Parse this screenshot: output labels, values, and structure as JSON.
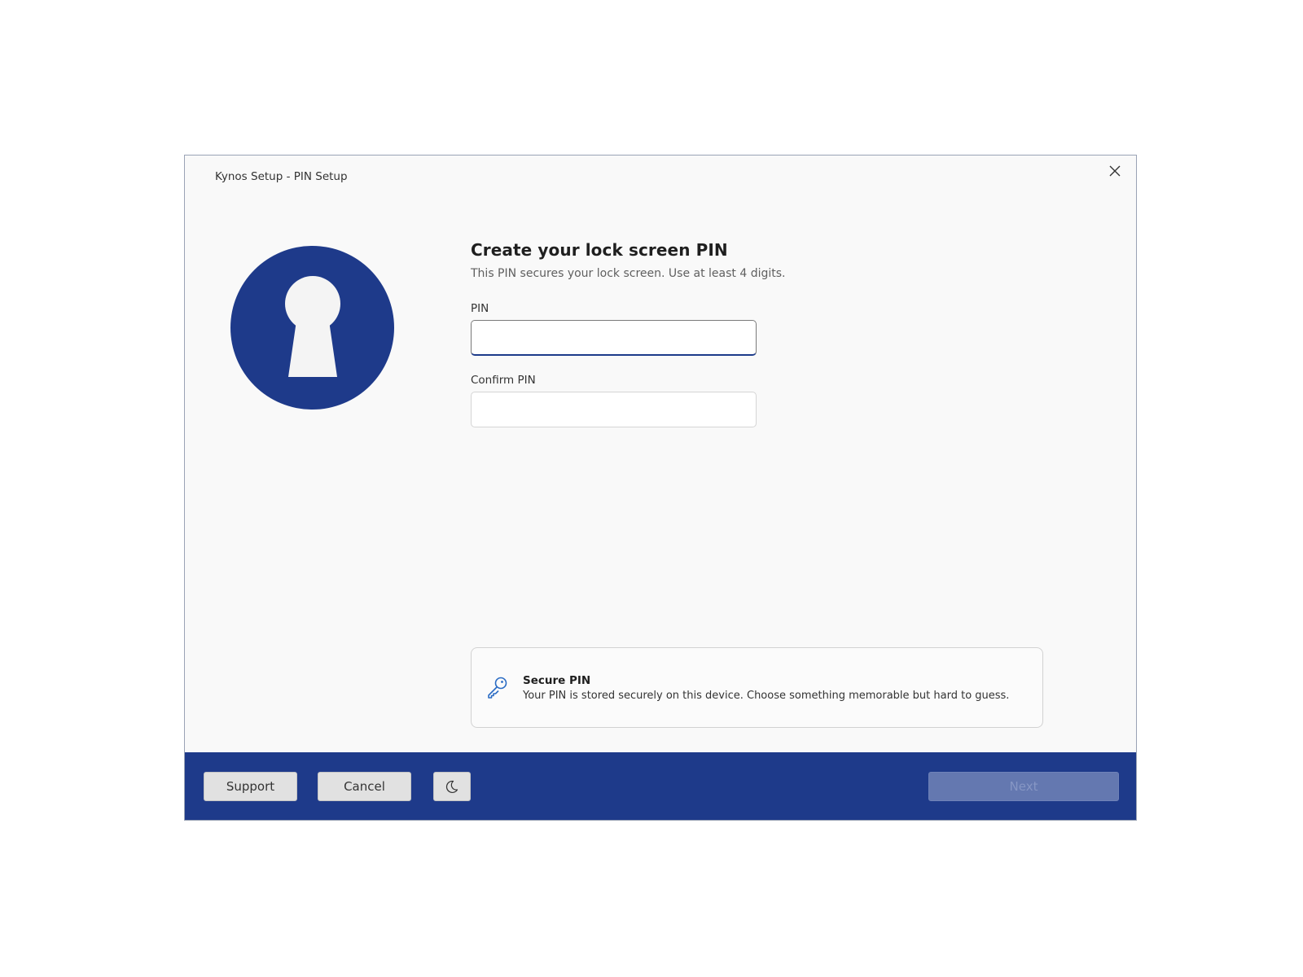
{
  "window": {
    "title": "Kynos Setup - PIN Setup"
  },
  "icons": {
    "close": "close-icon",
    "hero": "keyhole-icon",
    "info": "key-icon",
    "theme": "moon-icon"
  },
  "colors": {
    "brand": "#1e3a8a",
    "hero_fill": "#1e3a8a",
    "next_disabled": "#6478b0",
    "info_icon": "#2b6cc4"
  },
  "content": {
    "heading": "Create your lock screen PIN",
    "subtext": "This PIN secures your lock screen. Use at least 4 digits.",
    "pin": {
      "label": "PIN",
      "value": "",
      "placeholder": ""
    },
    "confirm": {
      "label": "Confirm PIN",
      "value": "",
      "placeholder": ""
    }
  },
  "info": {
    "title": "Secure PIN",
    "body": "Your PIN is stored securely on this device. Choose something memorable but hard to guess."
  },
  "footer": {
    "support_label": "Support",
    "cancel_label": "Cancel",
    "next_label": "Next"
  }
}
